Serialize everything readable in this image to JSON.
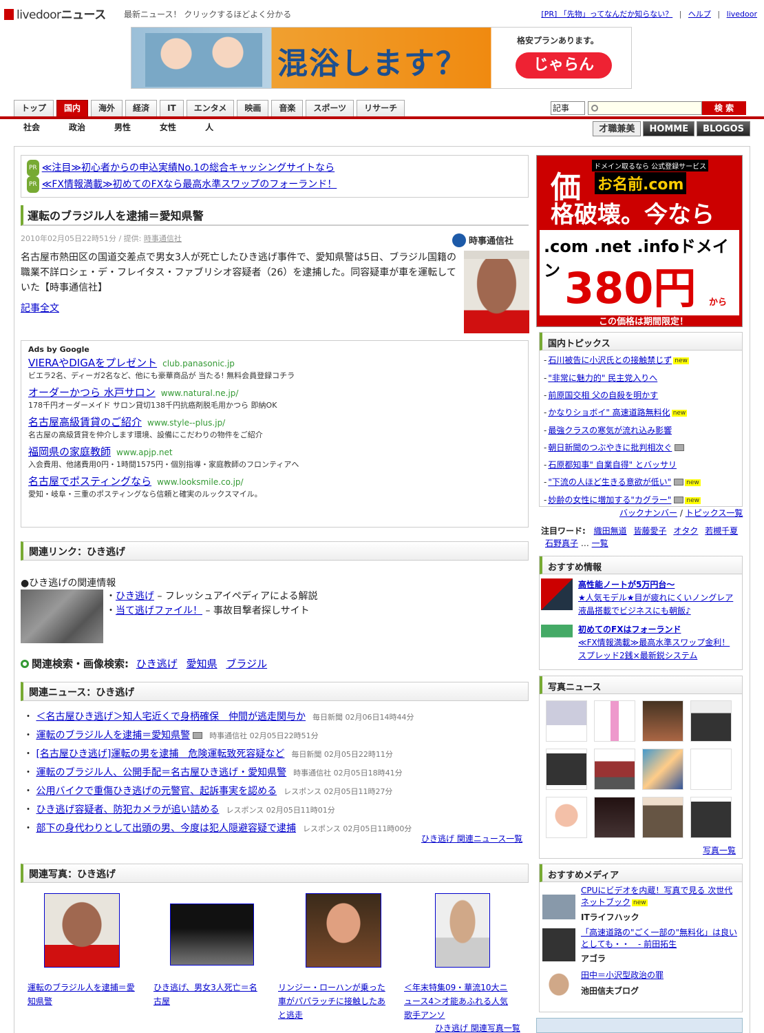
{
  "header": {
    "logo_livedoor": "livedoor",
    "logo_news": "ニュース",
    "tagline": "最新ニュース！ クリックするほどよく分かる",
    "pr_link": "[PR] 「先物」ってなんだか知らない？",
    "help": "ヘルプ",
    "livedoor": "livedoor"
  },
  "banner": {
    "main": "混浴します？",
    "side1": "格安プランあります。",
    "side2": "じゃらん"
  },
  "nav": {
    "tabs": [
      "トップ",
      "国内",
      "海外",
      "経済",
      "IT",
      "エンタメ",
      "映画",
      "音楽",
      "スポーツ",
      "リサーチ"
    ],
    "active_tab": "国内",
    "search_select": "記事",
    "search_button": "検 索",
    "subnav": [
      "社会",
      "政治",
      "男性",
      "女性",
      "人"
    ],
    "partners": [
      "才職兼美",
      "HOMME",
      "BLOGOS"
    ]
  },
  "pr_links": [
    {
      "badge": "PR",
      "text": "≪注目≫初心者からの申込実績No.1の総合キャッシングサイトなら"
    },
    {
      "badge": "PR",
      "text": "≪FX情報満載≫初めてのFXなら最高水準スワップのフォーランド！"
    }
  ],
  "article": {
    "title": "運転のブラジル人を逮捕＝愛知県警",
    "meta_date": "2010年02月05日22時51分 / 提供: ",
    "meta_source": "時事通信社",
    "source_logo": "時事通信社",
    "body": "名古屋市熱田区の国道交差点で男女3人が死亡したひき逃げ事件で、愛知県警は5日、ブラジル国籍の職業不詳ロシェ・デ・フレイタス・ファブリシオ容疑者（26）を逮捕した。同容疑車が車を運転していた【時事通信社】",
    "read_more": "記事全文"
  },
  "google_ads": {
    "label": "Ads by Google",
    "items": [
      {
        "title": "VIERAやDIGAをプレゼント",
        "url": "club.panasonic.jp",
        "desc": "ビエラ2名、ディーガ2名など、他にも豪華商品が 当たる! 無料会員登録コチラ"
      },
      {
        "title": "オーダーかつら 水戸サロン",
        "url": "www.natural.ne.jp/",
        "desc": "178千円オーダーメイド サロン貸切138千円抗癌剤脱毛用かつら 即納OK"
      },
      {
        "title": "名古屋高級賃貸のご紹介",
        "url": "www.style--plus.jp/",
        "desc": "名古屋の高級賃貸を仲介します環境、設備にこだわりの物件をご紹介"
      },
      {
        "title": "福岡県の家庭教師",
        "url": "www.apjp.net",
        "desc": "入会費用、他諸費用0円・1時間1575円・個別指導・家庭教師のフロンティアへ"
      },
      {
        "title": "名古屋でポスティングなら",
        "url": "www.looksmile.co.jp/",
        "desc": "愛知・岐阜・三重のポスティングなら信頼と確実のルックスマイル。"
      }
    ]
  },
  "related_links": {
    "heading": "関連リンク：ひき逃げ",
    "info_title": "●ひき逃げの関連情報",
    "items": [
      {
        "link": "ひき逃げ",
        "desc": " – フレッシュアイペディアによる解説"
      },
      {
        "link": "当て逃げファイル！",
        "desc": " – 事故目撃者探しサイト"
      }
    ]
  },
  "related_search": {
    "label": "関連検索・画像検索:",
    "terms": [
      "ひき逃げ",
      "愛知県",
      "ブラジル"
    ]
  },
  "related_news": {
    "heading": "関連ニュース：ひき逃げ",
    "items": [
      {
        "title": "＜名古屋ひき逃げ＞知人宅近くで身柄確保　仲間が逃走関与か",
        "src": "毎日新聞 02月06日14時44分",
        "cam": false
      },
      {
        "title": "運転のブラジル人を逮捕＝愛知県警",
        "src": "時事通信社 02月05日22時51分",
        "cam": true
      },
      {
        "title": "[名古屋ひき逃げ]運転の男を逮捕　危険運転致死容疑など",
        "src": "毎日新聞 02月05日22時11分",
        "cam": false
      },
      {
        "title": "運転のブラジル人、公開手配＝名古屋ひき逃げ・愛知県警",
        "src": "時事通信社 02月05日18時41分",
        "cam": false
      },
      {
        "title": "公用バイクで重傷ひき逃げの元警官、起訴事実を認める",
        "src": "レスポンス 02月05日11時27分",
        "cam": false
      },
      {
        "title": "ひき逃げ容疑者、防犯カメラが追い詰める",
        "src": "レスポンス 02月05日11時01分",
        "cam": false
      },
      {
        "title": "部下の身代わりとして出頭の男、今度は犯人隠避容疑で逮捕",
        "src": "レスポンス 02月05日11時00分",
        "cam": false
      }
    ],
    "more": "ひき逃げ 関連ニュース一覧"
  },
  "related_photos": {
    "heading": "関連写真：ひき逃げ",
    "items": [
      "運転のブラジル人を逮捕＝愛知県警",
      "ひき逃げ、男女3人死亡＝名古屋",
      "リンジー・ローハンが乗った車がパパラッチに接触したあと逃走",
      "＜年末特集09・華流10大ニュース4＞才能あふれる人気歌手アンソ"
    ],
    "more": "ひき逃げ 関連写真一覧"
  },
  "right_ad": {
    "line1": "価",
    "domain_label": "ドメイン取るなら 公式登録サービス",
    "brand": "お名前.com",
    "line2": "格破壊。今なら",
    "line3": ".com .net .infoドメイン",
    "price": "380円",
    "from": "から",
    "note": "この価格は期間限定！"
  },
  "topics": {
    "heading": "国内トピックス",
    "items": [
      {
        "text": "石川被告に小沢氏との接触禁じず",
        "new": true,
        "cam": false
      },
      {
        "text": "\"非常に魅力的\" 民主党入りへ",
        "new": false,
        "cam": false
      },
      {
        "text": "前原国交相 父の自殺を明かす",
        "new": false,
        "cam": false
      },
      {
        "text": "かなりショボイ\" 高速道路無料化",
        "new": true,
        "cam": false
      },
      {
        "text": "最強クラスの寒気が流れ込み影響",
        "new": false,
        "cam": false
      },
      {
        "text": "朝日新聞のつぶやきに批判相次ぐ",
        "new": false,
        "cam": true
      },
      {
        "text": "石原都知事\" 自業自得\" とバッサリ",
        "new": false,
        "cam": false
      },
      {
        "text": "\"下流の人ほど生きる意欲が低い\"",
        "new": true,
        "cam": true
      },
      {
        "text": "妙齢の女性に増加する\"カグラー\"",
        "new": true,
        "cam": true
      }
    ],
    "backnumber": "バックナンバー",
    "sep": " / ",
    "list": "トピックス一覧",
    "new_label": "new"
  },
  "trend_words": {
    "label": "注目ワード:",
    "words": [
      "織田無道",
      "皆藤愛子",
      "オタク",
      "若槻千夏",
      "石野真子"
    ],
    "more": "一覧"
  },
  "recommend": {
    "heading": "おすすめ情報",
    "items": [
      {
        "title": "高性能ノートが5万円台〜",
        "lines": [
          "★人気モデル★目が疲れにくいノングレア",
          "液晶搭載でビジネスにも朝飯♪"
        ]
      },
      {
        "title": "初めてのFXはフォーランド",
        "lines": [
          "≪FX情報満載≫最高水準スワップ金利！",
          "スプレッド2銭×最新鋭システム"
        ]
      }
    ]
  },
  "photo_news": {
    "heading": "写真ニュース",
    "more": "写真一覧"
  },
  "media": {
    "heading": "おすすめメディア",
    "items": [
      {
        "link": "CPUにビデオを内蔵！写真で見る 次世代ネットブック",
        "name": "ITライフハック",
        "new": true
      },
      {
        "link": "「高速道路の\"ごく一部の\"無料化」は良いとしても・・　- 前田拓生",
        "name": "アゴラ",
        "new": false
      },
      {
        "link": "田中＝小沢型政治の罪",
        "name": "池田信夫ブログ",
        "new": false
      }
    ]
  },
  "colors": {
    "brand_red": "#cc0000",
    "accent_green": "#77aa33",
    "link_blue": "#0000cc"
  }
}
